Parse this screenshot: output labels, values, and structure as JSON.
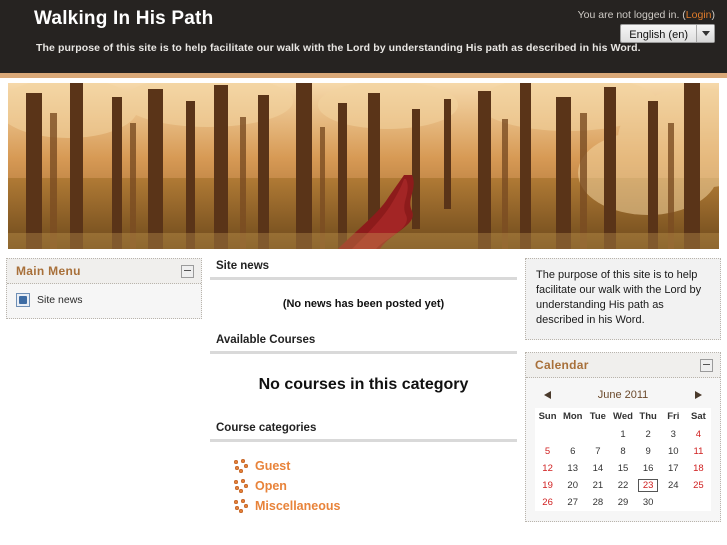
{
  "header": {
    "site_title": "Walking In His Path",
    "tagline": "The purpose of this site is to help facilitate our walk with the Lord by understanding His path as described in his Word.",
    "login_status": "You are not logged in. (",
    "login_link": "Login",
    "login_status_close": ")",
    "language_selected": "English (en)",
    "accent_color": "#e07b2a"
  },
  "banner": {
    "alt": "Autumn forest path photograph in sepia tones with a deep red trail"
  },
  "sidebar_left": {
    "blocks": [
      {
        "title": "Main Menu",
        "minimise_label": "",
        "items": [
          {
            "label": "Site news",
            "icon": "forum-icon"
          }
        ]
      }
    ]
  },
  "main": {
    "sections": [
      {
        "heading": "Site news",
        "body": "(No news has been posted yet)"
      },
      {
        "heading": "Available Courses",
        "body": "No courses in this category"
      },
      {
        "heading": "Course categories"
      }
    ],
    "categories": [
      {
        "label": "Guest"
      },
      {
        "label": "Open"
      },
      {
        "label": "Miscellaneous"
      }
    ]
  },
  "sidebar_right": {
    "description_block": {
      "text": "The purpose of this site is to help facilitate our walk with the Lord by understanding His path as described in his Word."
    },
    "calendar": {
      "title": "Calendar",
      "month_label": "June 2011",
      "prev_label": "",
      "next_label": "",
      "weekdays": [
        "Sun",
        "Mon",
        "Tue",
        "Wed",
        "Thu",
        "Fri",
        "Sat"
      ],
      "today": 23,
      "weekend_color": "#d02020",
      "weeks": [
        [
          "",
          "",
          "",
          "1",
          "2",
          "3",
          "4"
        ],
        [
          "5",
          "6",
          "7",
          "8",
          "9",
          "10",
          "11"
        ],
        [
          "12",
          "13",
          "14",
          "15",
          "16",
          "17",
          "18"
        ],
        [
          "19",
          "20",
          "21",
          "22",
          "23",
          "24",
          "25"
        ],
        [
          "26",
          "27",
          "28",
          "29",
          "30",
          "",
          ""
        ]
      ]
    }
  }
}
